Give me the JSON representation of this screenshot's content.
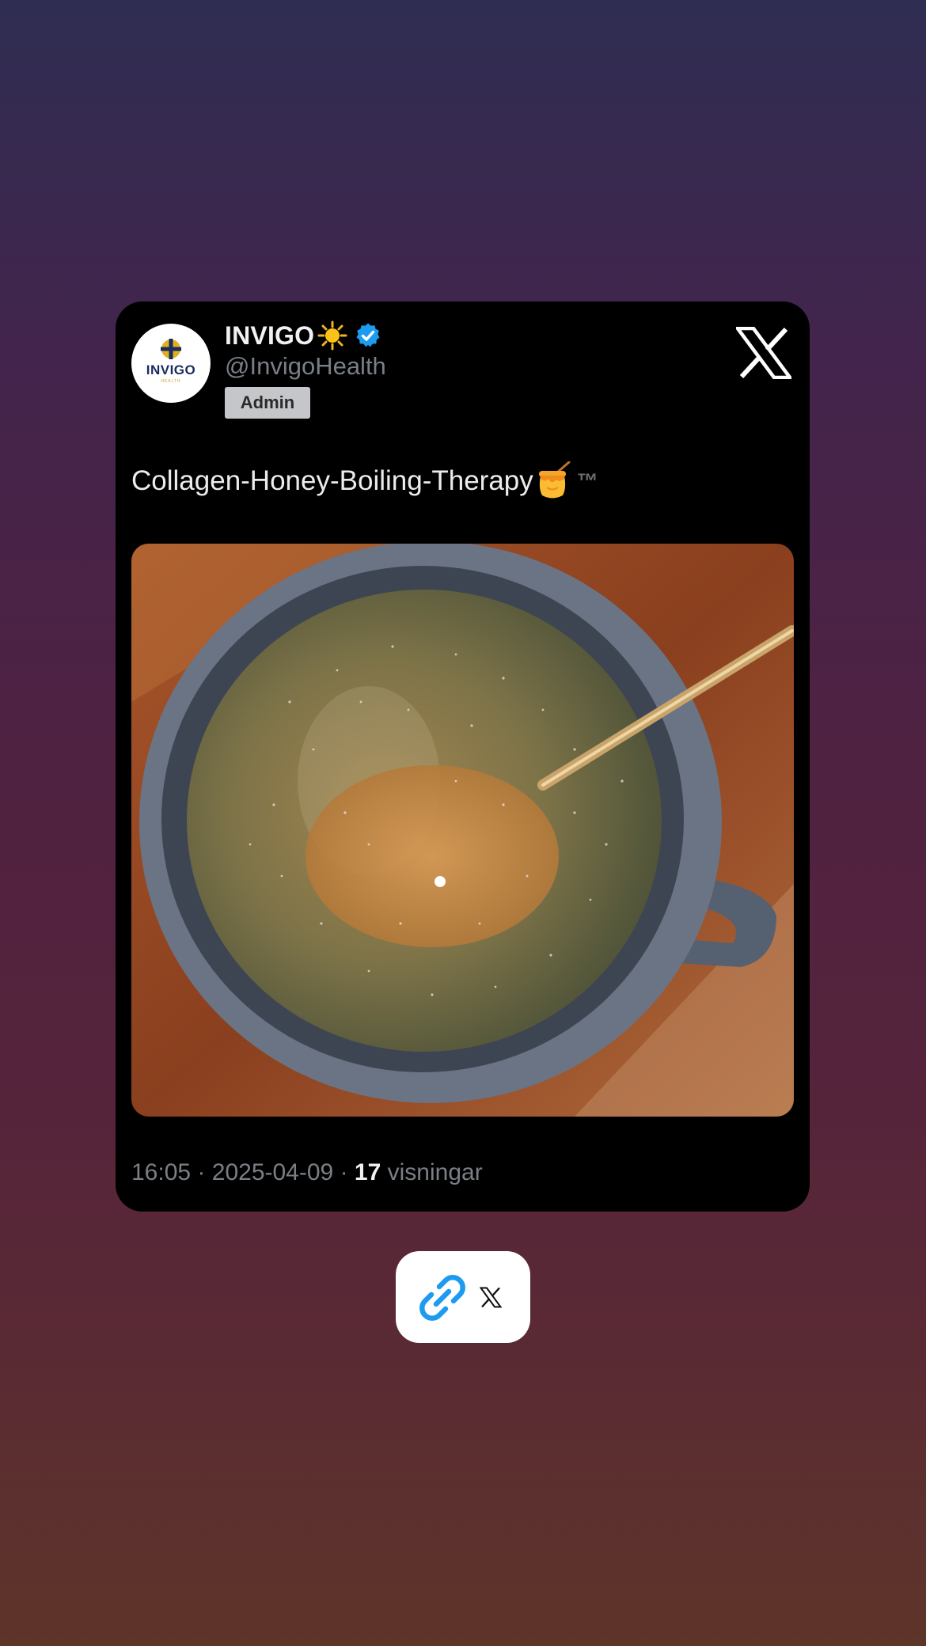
{
  "tweet": {
    "display_name": "INVIGO",
    "name_emoji": "sun-emoji",
    "verified": true,
    "handle": "@InvigoHealth",
    "badge": "Admin",
    "text": "Collagen-Honey-Boiling-Therapy",
    "text_emoji": "honey-pot-emoji",
    "trademark": "™",
    "image": "photo of a grey mug with warm collagen-honey water and a spoon on a wooden table",
    "time": "16:05",
    "date": "2025-04-09",
    "separator": "·",
    "views_count": "17",
    "views_label": "visningar"
  },
  "avatar": {
    "word": "INVIGO",
    "sub": "HEALTH"
  },
  "share_button": {
    "icons": [
      "link-icon",
      "x-logo-icon"
    ]
  },
  "colors": {
    "card_bg": "#000000",
    "verified_blue": "#1d9bf0",
    "link_blue": "#1d9bf0",
    "handle_gray": "#7a7f86"
  }
}
